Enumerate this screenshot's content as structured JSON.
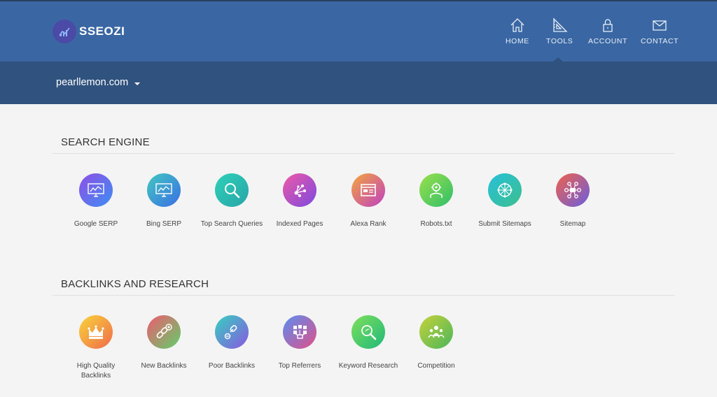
{
  "brand": {
    "name": "SSEOZI"
  },
  "nav": [
    {
      "label": "HOME",
      "icon": "home-icon"
    },
    {
      "label": "TOOLS",
      "icon": "tools-icon",
      "active": true
    },
    {
      "label": "ACCOUNT",
      "icon": "lock-icon"
    },
    {
      "label": "CONTACT",
      "icon": "envelope-icon"
    }
  ],
  "site_selector": {
    "value": "pearllemon.com"
  },
  "sections": [
    {
      "title": "SEARCH ENGINE",
      "tools": [
        {
          "label": "Google SERP",
          "icon": "monitor-chart-icon",
          "colors": [
            "#8f4fe6",
            "#3d8ef2"
          ]
        },
        {
          "label": "Bing SERP",
          "icon": "monitor-chart-icon",
          "colors": [
            "#42c8c0",
            "#3a6ee6"
          ]
        },
        {
          "label": "Top Search Queries",
          "icon": "magnifier-icon",
          "colors": [
            "#2ed1b8",
            "#28a4a8"
          ]
        },
        {
          "label": "Indexed Pages",
          "icon": "network-icon",
          "colors": [
            "#f05aa6",
            "#7b48e0"
          ]
        },
        {
          "label": "Alexa Rank",
          "icon": "browser-window-icon",
          "colors": [
            "#f4a63c",
            "#c03fc2"
          ]
        },
        {
          "label": "Robots.txt",
          "icon": "robot-icon",
          "colors": [
            "#9be04a",
            "#2fbf6a"
          ]
        },
        {
          "label": "Submit Sitemaps",
          "icon": "sitemap-globe-icon",
          "colors": [
            "#28c0d8",
            "#3bbf8e"
          ]
        },
        {
          "label": "Sitemap",
          "icon": "sitemap-nodes-icon",
          "colors": [
            "#f0604a",
            "#6a5fe0"
          ]
        }
      ]
    },
    {
      "title": "BACKLINKS AND RESEARCH",
      "tools": [
        {
          "label": "High Quality Backlinks",
          "label_lines": [
            "High Quality",
            "Backlinks"
          ],
          "icon": "crown-icon",
          "colors": [
            "#f8d53a",
            "#f06a4a"
          ]
        },
        {
          "label": "New Backlinks",
          "icon": "link-plus-icon",
          "colors": [
            "#f05a70",
            "#5fd06a"
          ]
        },
        {
          "label": "Poor Backlinks",
          "icon": "chain-icon",
          "colors": [
            "#35d1c0",
            "#8a56e0"
          ]
        },
        {
          "label": "Top Referrers",
          "icon": "social-share-icon",
          "colors": [
            "#5a8ef0",
            "#e0508a"
          ]
        },
        {
          "label": "Keyword Research",
          "icon": "keyword-magnifier-icon",
          "colors": [
            "#7ee05a",
            "#1fb87a"
          ]
        },
        {
          "label": "Competition",
          "icon": "competition-people-icon",
          "colors": [
            "#c6d23a",
            "#4ab65a"
          ]
        }
      ]
    }
  ]
}
